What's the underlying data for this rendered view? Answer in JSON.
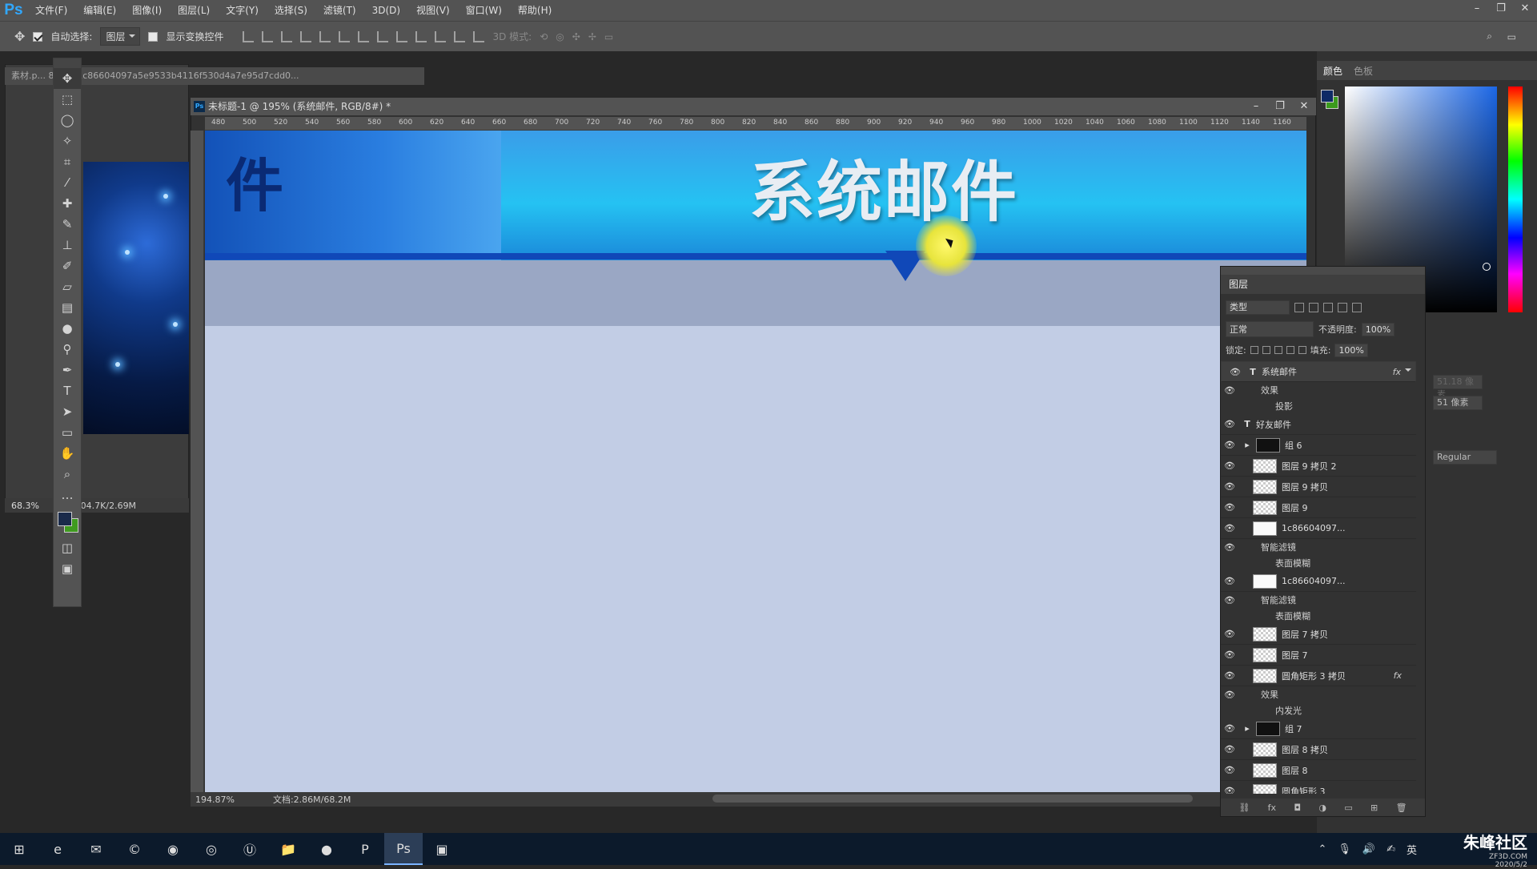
{
  "menubar": {
    "logo": "Ps",
    "items": [
      "文件(F)",
      "编辑(E)",
      "图像(I)",
      "图层(L)",
      "文字(Y)",
      "选择(S)",
      "滤镜(T)",
      "3D(D)",
      "视图(V)",
      "窗口(W)",
      "帮助(H)"
    ]
  },
  "options": {
    "auto_select_label": "自动选择:",
    "auto_select_value": "图层",
    "show_transform_label": "显示变换控件",
    "mode3d_label": "3D 模式:"
  },
  "bgdoc": {
    "tab_title": "素材.p... 8.3% (1c86604097a5e9533b4116f530d4a7e95d7cdd0...",
    "zoom": "68.3%",
    "doc_size": "档:704.7K/2.69M"
  },
  "doc": {
    "tab_title": "未标题-1 @ 195% (系统邮件, RGB/8#) *",
    "ruler_labels": [
      "480",
      "500",
      "520",
      "540",
      "560",
      "580",
      "600",
      "620",
      "640",
      "660",
      "680",
      "700",
      "720",
      "740",
      "760",
      "780",
      "800",
      "820",
      "840",
      "860",
      "880",
      "900",
      "920",
      "940",
      "960",
      "980",
      "1000",
      "1020",
      "1040",
      "1060",
      "1080",
      "1100",
      "1120",
      "1140",
      "1160"
    ],
    "zoom": "194.87%",
    "doc_size": "文档:2.86M/68.2M"
  },
  "banner": {
    "title": "系统邮件",
    "partial": "件"
  },
  "colorpanel": {
    "tabs": [
      "颜色",
      "色板"
    ],
    "font_size_value": "51.18 像素",
    "leading_value": "51 像素",
    "font_style_value": "Regular"
  },
  "layers": {
    "title": "图层",
    "filter_kind": "类型",
    "blend_mode": "正常",
    "opacity_label": "不透明度:",
    "opacity_value": "100%",
    "lock_label": "锁定:",
    "fill_label": "填充:",
    "fill_value": "100%",
    "rows": [
      {
        "name": "系统邮件",
        "type": "text",
        "fx": true,
        "selected": true
      },
      {
        "name": "效果",
        "type": "sub"
      },
      {
        "name": "投影",
        "type": "sub2"
      },
      {
        "name": "好友邮件",
        "type": "text"
      },
      {
        "name": "组 6",
        "type": "group"
      },
      {
        "name": "图层 9 拷贝 2",
        "type": "layer"
      },
      {
        "name": "图层 9 拷贝",
        "type": "layer"
      },
      {
        "name": "图层 9",
        "type": "layer"
      },
      {
        "name": "1c86604097...",
        "type": "smart"
      },
      {
        "name": "智能滤镜",
        "type": "sub"
      },
      {
        "name": "表面模糊",
        "type": "sub2"
      },
      {
        "name": "1c86604097...",
        "type": "smart"
      },
      {
        "name": "智能滤镜",
        "type": "sub"
      },
      {
        "name": "表面模糊",
        "type": "sub2"
      },
      {
        "name": "图层 7 拷贝",
        "type": "layer"
      },
      {
        "name": "图层 7",
        "type": "layer"
      },
      {
        "name": "圆角矩形 3 拷贝",
        "type": "shape",
        "fx": true
      },
      {
        "name": "效果",
        "type": "sub"
      },
      {
        "name": "内发光",
        "type": "sub2"
      },
      {
        "name": "组 7",
        "type": "group"
      },
      {
        "name": "图层 8 拷贝",
        "type": "layer"
      },
      {
        "name": "图层 8",
        "type": "layer"
      },
      {
        "name": "圆角矩形 3",
        "type": "shape"
      }
    ],
    "footer_fx": "fx"
  },
  "taskbar": {
    "tray_lang": "英"
  },
  "watermark": {
    "brand": "朱峰社区",
    "url": "ZF3D.COM",
    "date": "2020/5/2"
  }
}
